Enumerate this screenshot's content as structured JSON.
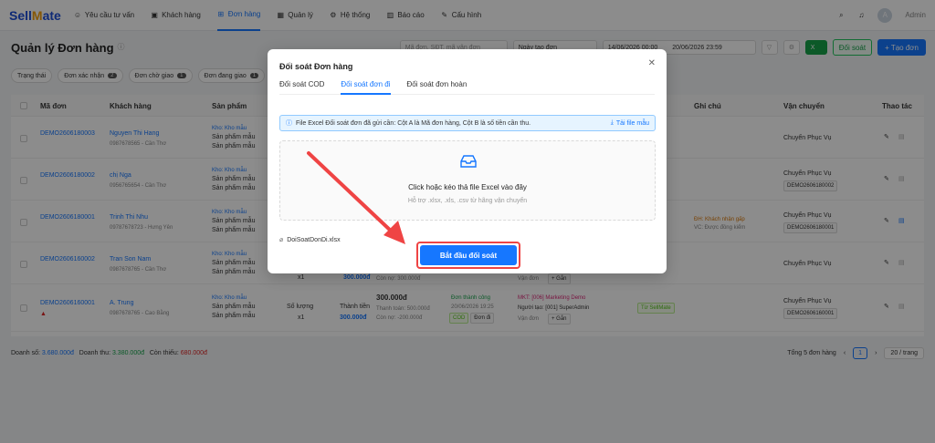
{
  "app": {
    "logo_part1": "Sell",
    "logo_part2": "Mate",
    "logo_part3": "te"
  },
  "nav": [
    {
      "icon": "chat-icon",
      "label": "Yêu cầu tư vấn"
    },
    {
      "icon": "customer-icon",
      "label": "Khách hàng"
    },
    {
      "icon": "cart-icon",
      "label": "Đơn hàng"
    },
    {
      "icon": "grid-icon",
      "label": "Quản lý"
    },
    {
      "icon": "gear-icon",
      "label": "Hệ thống"
    },
    {
      "icon": "chart-icon",
      "label": "Báo cáo"
    },
    {
      "icon": "wrench-icon",
      "label": "Cấu hình"
    }
  ],
  "user": {
    "avatar": "A",
    "name": "Admin"
  },
  "page": {
    "title": "Quản lý Đơn hàng",
    "search_placeholder": "Mã đơn, SĐT, mã vận đơn",
    "date_type": "Ngày tạo đơn",
    "date_from": "14/06/2026 00:00",
    "date_to": "20/06/2026 23:59",
    "reconcile_label": "Đối soát",
    "create_label": "+ Tạo đơn"
  },
  "status_chips": [
    {
      "label": "Trạng thái",
      "count": ""
    },
    {
      "label": "Đơn xác nhận",
      "count": "2"
    },
    {
      "label": "Đơn chờ giao",
      "count": "1"
    },
    {
      "label": "Đơn đang giao",
      "count": "1"
    }
  ],
  "table": {
    "headers": {
      "code": "Mã đơn",
      "customer": "Khách hàng",
      "product": "Sản phẩm",
      "note": "Ghi chú",
      "shipping": "Vận chuyển",
      "actions": "Thao tác"
    },
    "rows": [
      {
        "code": "DEMO2606180003",
        "name": "Nguyen Thi Hang",
        "phone": "0987678565 - Cần Thơ",
        "warehouse": "Kho: Kho mẫu",
        "p1": "Sản phẩm mẫu",
        "p2": "Sản phẩm mẫu",
        "ship": "Chuyển Phục Vụ",
        "ship_code": ""
      },
      {
        "code": "DEMO2606180002",
        "name": "chị Nga",
        "phone": "0956765654 - Cần Thơ",
        "warehouse": "Kho: Kho mẫu",
        "p1": "Sản phẩm mẫu",
        "p2": "Sản phẩm mẫu",
        "ship": "Chuyển Phục Vụ",
        "ship_code": "DEMO2606180002"
      },
      {
        "code": "DEMO2606180001",
        "name": "Trinh Thi Nhu",
        "phone": "09787678723 - Hưng Yên",
        "warehouse": "Kho: Kho mẫu",
        "p1": "Sản phẩm mẫu",
        "p2": "Sản phẩm mẫu",
        "ship": "Chuyển Phục Vụ",
        "ship_code": "DEMO2606180001",
        "note1": "ĐH: Khách nhận gấp",
        "note2": "VC: Được đồng kiểm"
      },
      {
        "code": "DEMO2606160002",
        "name": "Tran Son Nam",
        "phone": "0987678765 - Cần Thơ",
        "warehouse": "Kho: Kho mẫu",
        "p1": "Sản phẩm mẫu",
        "p2": "Sản phẩm mẫu",
        "ship": "Chuyển Phục Vụ",
        "ship_code": "",
        "qty": "x1",
        "price": "300.000đ",
        "debt": "Còn nợ: 300.000đ",
        "vd": "Vận đơn",
        "add": "+ Gắn"
      },
      {
        "code": "DEMO2606160001",
        "name": "A. Trung",
        "phone": "0987678765 - Cao Bằng",
        "warehouse": "Kho: Kho mẫu",
        "p1": "Sản phẩm mẫu",
        "p2": "Sản phẩm mẫu",
        "ship": "Chuyển Phục Vụ",
        "ship_code": "DEMO2606160001",
        "qty_label": "Số lượng",
        "qty": "x1",
        "price_label": "Thành tiền",
        "price": "300.000đ",
        "total": "300.000đ",
        "paid": "Thanh toán: 500.000đ",
        "debt": "Còn nợ: -200.000đ",
        "status": "Đơn thành công",
        "status_time": "20/06/2026 19:25",
        "cod": "COD",
        "done": "Đơn đi",
        "mkt": "MKT: [006] Marketing Demo",
        "creator": "Người tạo: [001] SuperAdmin",
        "vd": "Vận đơn",
        "add": "+ Gắn",
        "source": "Từ SellMate"
      }
    ]
  },
  "footer": {
    "revenue_label": "Doanh số:",
    "revenue": "3.680.000đ",
    "income_label": "Doanh thu:",
    "income": "3.380.000đ",
    "debt_label": "Còn thiếu:",
    "debt": "680.000đ",
    "total_label": "Tổng 5 đơn hàng",
    "page": "1",
    "per_page": "20 / trang"
  },
  "modal": {
    "title": "Đối soát Đơn hàng",
    "tabs": [
      "Đối soát COD",
      "Đối soát đơn đi",
      "Đối soát đơn hoàn"
    ],
    "active_tab": 1,
    "info": "File Excel Đối soát đơn đã gửi cần: Cột A là Mã đơn hàng, Cột B là số tiền cần thu.",
    "download": "Tải file mẫu",
    "drop_title": "Click hoặc kéo thả file Excel vào đây",
    "drop_sub": "Hỗ trợ .xlsx, .xls, .csv từ hãng vận chuyển",
    "file_name": "DoiSoatDonDi.xlsx",
    "start_label": "Bắt đầu đối soát"
  },
  "colors": {
    "primary": "#1677ff",
    "highlight": "#ef4444"
  }
}
